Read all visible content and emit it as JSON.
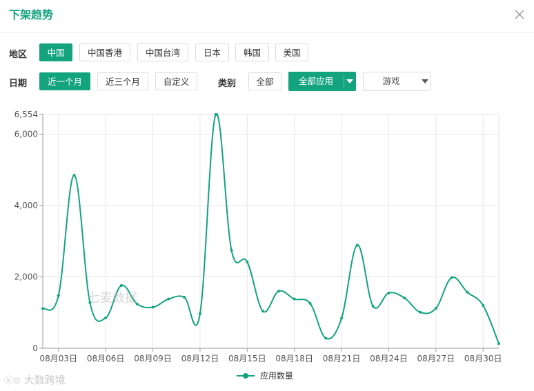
{
  "dialog": {
    "title": "下架趋势"
  },
  "filters": {
    "region_label": "地区",
    "regions": [
      "中国",
      "中国香港",
      "中国台湾",
      "日本",
      "韩国",
      "美国"
    ],
    "date_label": "日期",
    "dates": [
      "近一个月",
      "近三个月",
      "自定义"
    ],
    "category_label": "类别",
    "category_all": "全部",
    "category_apps": "全部应用",
    "category_game": "游戏"
  },
  "colors": {
    "accent": "#13a37f",
    "grid": "#e6e6e6",
    "axis": "#666666"
  },
  "chart_data": {
    "type": "line",
    "x": [
      "08月02日",
      "08月03日",
      "08月04日",
      "08月05日",
      "08月06日",
      "08月07日",
      "08月08日",
      "08月09日",
      "08月10日",
      "08月11日",
      "08月12日",
      "08月13日",
      "08月14日",
      "08月15日",
      "08月16日",
      "08月17日",
      "08月18日",
      "08月19日",
      "08月20日",
      "08月21日",
      "08月22日",
      "08月23日",
      "08月24日",
      "08月25日",
      "08月26日",
      "08月27日",
      "08月28日",
      "08月29日",
      "08月30日",
      "08月31日"
    ],
    "xticks": [
      "08月03日",
      "08月06日",
      "08月09日",
      "08月12日",
      "08月15日",
      "08月18日",
      "08月21日",
      "08月24日",
      "08月27日",
      "08月30日"
    ],
    "yticks": [
      "0",
      "2,000",
      "4,000",
      "6,000",
      "6,554"
    ],
    "series": [
      {
        "name": "应用数量",
        "values": [
          1110,
          1480,
          4850,
          1280,
          850,
          1760,
          1240,
          1150,
          1380,
          1430,
          970,
          6554,
          2750,
          2420,
          1040,
          1600,
          1380,
          1260,
          280,
          840,
          2890,
          1180,
          1550,
          1410,
          1010,
          1120,
          1980,
          1570,
          1200,
          130
        ]
      }
    ],
    "ylim": [
      0,
      6554
    ],
    "grid": true,
    "legend": "bottom",
    "watermark": "七麦数据"
  },
  "footer": {
    "watermark": "大数跨境"
  }
}
